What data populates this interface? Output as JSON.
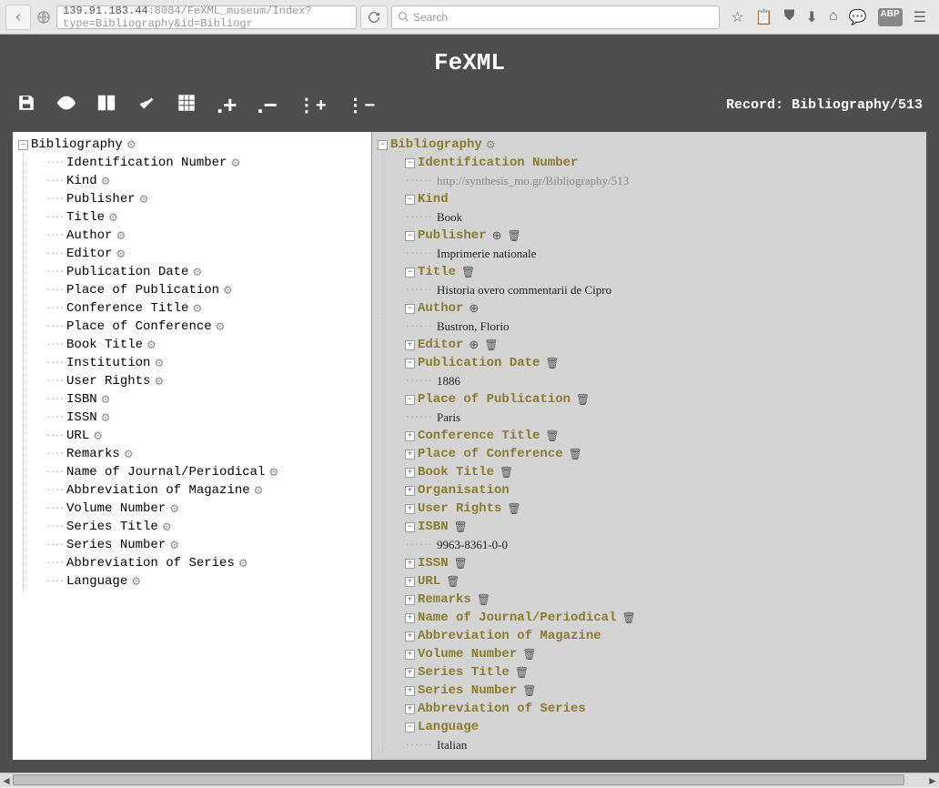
{
  "browser": {
    "url_host": "139.91.183.44",
    "url_port": ":8084",
    "url_path": "/FeXML_museum/Index?type=Bibliography&id=Bibliogr",
    "search_placeholder": "Search"
  },
  "app": {
    "title": "FeXML",
    "record_label": "Record: Bibliography/513"
  },
  "left_tree": {
    "root": "Bibliography",
    "items": [
      "Identification Number",
      "Kind",
      "Publisher",
      "Title",
      "Author",
      "Editor",
      "Publication Date",
      "Place of Publication",
      "Conference Title",
      "Place of Conference",
      "Book Title",
      "Institution",
      "User Rights",
      "ISBN",
      "ISSN",
      "URL",
      "Remarks",
      "Name of Journal/Periodical",
      "Abbreviation of Magazine",
      "Volume Number",
      "Series Title",
      "Series Number",
      "Abbreviation of Series",
      "Language"
    ]
  },
  "right_tree": {
    "root": "Bibliography",
    "identification_number": {
      "label": "Identification Number",
      "value": "http://synthesis_mo.gr/Bibliography/513"
    },
    "kind": {
      "label": "Kind",
      "value": "Book"
    },
    "publisher": {
      "label": "Publisher",
      "value": "Imprimerie nationale"
    },
    "title": {
      "label": "Title",
      "value": "Historia overo commentarii de Cipro"
    },
    "author": {
      "label": "Author",
      "value": "Bustron, Florio"
    },
    "editor": {
      "label": "Editor"
    },
    "publication_date": {
      "label": "Publication Date",
      "value": "1886"
    },
    "place_of_publication": {
      "label": "Place of Publication",
      "value": "Paris"
    },
    "conference_title": {
      "label": "Conference Title"
    },
    "place_of_conference": {
      "label": "Place of Conference"
    },
    "book_title": {
      "label": "Book Title"
    },
    "organisation": {
      "label": "Organisation"
    },
    "user_rights": {
      "label": "User Rights"
    },
    "isbn": {
      "label": "ISBN",
      "value": "9963-8361-0-0"
    },
    "issn": {
      "label": "ISSN"
    },
    "url": {
      "label": "URL"
    },
    "remarks": {
      "label": "Remarks"
    },
    "journal": {
      "label": "Name of Journal/Periodical"
    },
    "abbrev_mag": {
      "label": "Abbreviation of Magazine"
    },
    "volume": {
      "label": "Volume Number"
    },
    "series_title": {
      "label": "Series Title"
    },
    "series_number": {
      "label": "Series Number"
    },
    "abbrev_series": {
      "label": "Abbreviation of Series"
    },
    "language": {
      "label": "Language",
      "value": "Italian"
    }
  }
}
